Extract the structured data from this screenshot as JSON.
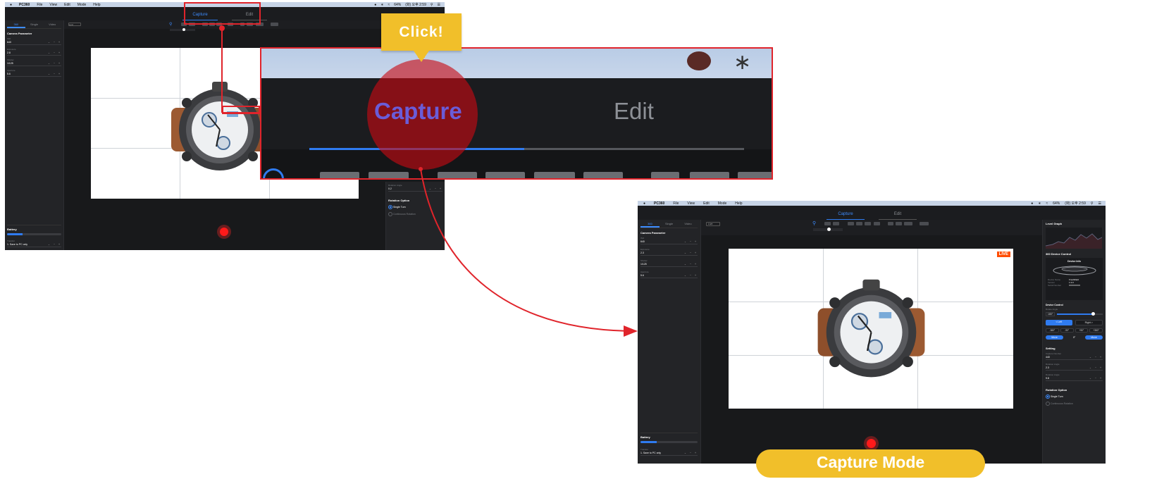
{
  "menubar": {
    "apple": "",
    "brand": "PC360",
    "items": [
      "File",
      "View",
      "Edit",
      "Mode",
      "Help"
    ],
    "status": [
      "64%",
      "(화) 오후 2:59"
    ]
  },
  "mode_tabs": [
    "Capture",
    "Edit"
  ],
  "left_panel": {
    "tabs": [
      "360",
      "Single",
      "Video"
    ],
    "section_title": "Camera Parameter",
    "params": [
      {
        "label": "ISO",
        "value": "640"
      },
      {
        "label": "Exposure",
        "value": "2.3"
      },
      {
        "label": "Shutter",
        "value": "1/125"
      },
      {
        "label": "Aperture",
        "value": "5.6"
      }
    ],
    "left_values_small": [
      "640",
      "2.8",
      "1/125",
      "5.6"
    ],
    "battery_title": "Battery",
    "battery_level": 0.28,
    "transfer_label": "Transfer",
    "transfer_value": "1. Save to PC only",
    "ctrl_glyphs": "⌄ − +"
  },
  "toolbar": {
    "preset": "Live",
    "small_preset": "sync"
  },
  "canvas": {
    "live_badge": "LIVE"
  },
  "right_panel": {
    "level_graph_title": "Level Graph",
    "device_control_title": "360 Device Control",
    "device_info_title": "Device Info",
    "device_info": [
      {
        "key": "Device Name",
        "value": "Freshifield"
      },
      {
        "key": "Version",
        "value": "1.3.0"
      },
      {
        "key": "Serial Number",
        "value": "XXXXXXXX"
      }
    ],
    "device_control_sub": "Device Control",
    "rotate_label": "Rotate Angle",
    "rotate_value": "180°",
    "rotate_level": 0.78,
    "left_btn": "< Left",
    "right_btn": "Right >",
    "angles": [
      "-360°",
      "-90°",
      "+90°",
      "+360°"
    ],
    "move_left": "Move",
    "move_value": "0°",
    "move_right": "Move",
    "setting_title": "Setting",
    "settings": [
      {
        "label": "Capture Number",
        "value": "440"
      },
      {
        "label": "Rotation Angle",
        "value": "2.3"
      },
      {
        "label": "Rotation Angle",
        "value": "9.8"
      }
    ],
    "left_setting_small": {
      "label": "Rotation Angle",
      "value": "0.2"
    },
    "rotation_option_title": "Rotation Option",
    "rotation_options": [
      "Single Turn",
      "Continuous Rotation"
    ]
  },
  "annotations": {
    "click_tag": "Click!",
    "mode_label": "Capture Mode"
  },
  "colors": {
    "accent": "#2f7bf0",
    "highlight": "#e0242b",
    "callout": "#f1bf2a",
    "record": "#ff1a1a"
  }
}
